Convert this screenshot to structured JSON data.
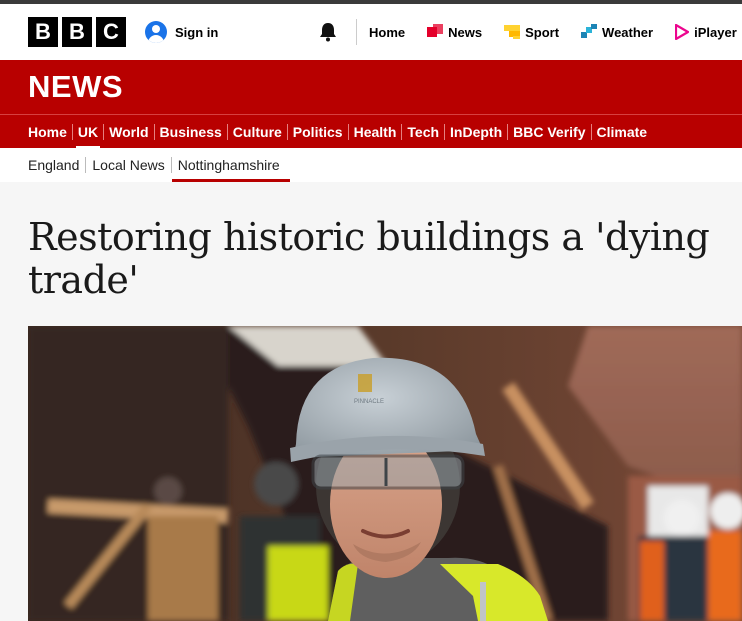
{
  "brand": {
    "letters": [
      "B",
      "B",
      "C"
    ],
    "section": "NEWS"
  },
  "account": {
    "signin_label": "Sign in"
  },
  "top_nav": [
    {
      "label": "Home",
      "icon": null
    },
    {
      "label": "News",
      "icon": "news-icon",
      "color": "#e4002b"
    },
    {
      "label": "Sport",
      "icon": "sport-icon",
      "color": "#ffd230"
    },
    {
      "label": "Weather",
      "icon": "weather-icon",
      "color": "#1d84b5"
    },
    {
      "label": "iPlayer",
      "icon": "iplayer-icon",
      "color": "#ec058e"
    }
  ],
  "main_nav": [
    "Home",
    "UK",
    "World",
    "Business",
    "Culture",
    "Politics",
    "Health",
    "Tech",
    "InDepth",
    "BBC Verify",
    "Climate"
  ],
  "main_nav_active": "UK",
  "sub_nav": [
    "England",
    "Local News",
    "Nottinghamshire"
  ],
  "sub_nav_active": "Nottinghamshire",
  "article": {
    "headline": "Restoring historic buildings a 'dying trade'",
    "image_alt": "Man in a grey hard hat, safety glasses and yellow hi-vis vest smiling at a building site",
    "helmet_text": "PINNACLE"
  },
  "colors": {
    "brand_red": "#b80000",
    "hivis": "#d8e82a"
  }
}
